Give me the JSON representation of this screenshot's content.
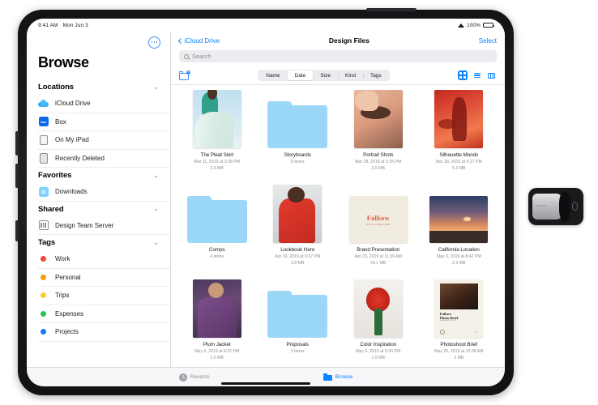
{
  "status_bar": {
    "time": "9:41 AM",
    "date": "Mon Jun 3",
    "wifi_icon": "wifi-icon",
    "battery_percent": "100%",
    "battery_icon": "battery-icon"
  },
  "sidebar": {
    "more_icon": "ellipsis-circle-icon",
    "title": "Browse",
    "sections": [
      {
        "header": "Locations",
        "chevron": "chevron-down-icon",
        "items": [
          {
            "label": "iCloud Drive",
            "icon": "icloud-drive-icon"
          },
          {
            "label": "Box",
            "icon": "box-app-icon",
            "icon_text": "box"
          },
          {
            "label": "On My iPad",
            "icon": "ipad-icon"
          },
          {
            "label": "Recently Deleted",
            "icon": "trash-ipad-icon"
          }
        ]
      },
      {
        "header": "Favorites",
        "chevron": "chevron-down-icon",
        "items": [
          {
            "label": "Downloads",
            "icon": "downloads-folder-icon"
          }
        ]
      },
      {
        "header": "Shared",
        "chevron": "chevron-down-icon",
        "items": [
          {
            "label": "Design Team Server",
            "icon": "server-icon"
          }
        ]
      },
      {
        "header": "Tags",
        "chevron": "chevron-down-icon",
        "items": [
          {
            "label": "Work",
            "icon": "tag-dot-icon",
            "color": "#f5463b"
          },
          {
            "label": "Personal",
            "icon": "tag-dot-icon",
            "color": "#f59f0b"
          },
          {
            "label": "Trips",
            "icon": "tag-dot-icon",
            "color": "#f7cf2e"
          },
          {
            "label": "Expenses",
            "icon": "tag-dot-icon",
            "color": "#2fc14f"
          },
          {
            "label": "Projects",
            "icon": "tag-dot-icon",
            "color": "#1a7bf0"
          }
        ]
      }
    ]
  },
  "detail": {
    "back_label": "iCloud Drive",
    "back_icon": "chevron-left-icon",
    "title": "Design Files",
    "select_label": "Select",
    "search": {
      "placeholder": "Search",
      "icon": "search-icon"
    },
    "new_folder_icon": "new-folder-icon",
    "sort_options": [
      "Name",
      "Date",
      "Size",
      "Kind",
      "Tags"
    ],
    "sort_selected": "Date",
    "view_modes": [
      {
        "name": "grid-view-icon",
        "active": true
      },
      {
        "name": "list-view-icon",
        "active": false
      },
      {
        "name": "column-view-icon",
        "active": false
      }
    ]
  },
  "files": [
    {
      "name": "The Pleat Skirt",
      "sub": "Mar 11, 2019 at 3:28 PM",
      "size": "2.6 MB",
      "type": "image",
      "art": "a-pleat",
      "shape": "tall"
    },
    {
      "name": "Storyboards",
      "sub": "8 items",
      "size": "",
      "type": "folder",
      "art": "",
      "shape": "folder"
    },
    {
      "name": "Portrait Shots",
      "sub": "Mar 28, 2019 at 5:25 PM",
      "size": "3.5 MB",
      "type": "image",
      "art": "a-portrait",
      "shape": "tall"
    },
    {
      "name": "Silhouette Moods",
      "sub": "Mar 28, 2019 at 6:17 PM",
      "size": "5.3 MB",
      "type": "image",
      "art": "a-silh",
      "shape": "tall"
    },
    {
      "name": "Comps",
      "sub": "4 items",
      "size": "",
      "type": "folder",
      "art": "",
      "shape": "folder"
    },
    {
      "name": "Lookbook Hero",
      "sub": "Apr 19, 2019 at 9:37 PM",
      "size": "3.8 MB",
      "type": "image",
      "art": "a-lookbook",
      "shape": "tall"
    },
    {
      "name": "Brand Presentation",
      "sub": "Apr 23, 2019 at 11:30 AM",
      "size": "54.1 MB",
      "type": "keynote",
      "art": "a-brand",
      "shape": "wide",
      "title_text": "Falkow",
      "subtitle_text": "Autumn / Winter 2019"
    },
    {
      "name": "California Location",
      "sub": "May 3, 2019 at 8:42 PM",
      "size": "2.3 MB",
      "type": "image",
      "art": "a-cali",
      "shape": "wide"
    },
    {
      "name": "Plum Jacket",
      "sub": "May 6, 2019 at 4:22 PM",
      "size": "1.6 MB",
      "type": "image",
      "art": "a-plum",
      "shape": "tall"
    },
    {
      "name": "Proposals",
      "sub": "3 items",
      "size": "",
      "type": "folder",
      "art": "",
      "shape": "folder"
    },
    {
      "name": "Color Inspiration",
      "sub": "May 6, 2019 at 5:34 PM",
      "size": "1.9 MB",
      "type": "image",
      "art": "a-color",
      "shape": "tall"
    },
    {
      "name": "Photoshoot Brief",
      "sub": "May 26, 2019 at 10:08 AM",
      "size": "2 MB",
      "type": "document",
      "art": "a-brief",
      "shape": "tall",
      "doc_title_1": "Falkow",
      "doc_title_2": "Photo Brief",
      "doc_sub": "LOOKBOOK F/W '19",
      "doc_page": "001"
    }
  ],
  "tab_bar": {
    "tabs": [
      {
        "label": "Recents",
        "icon": "clock-icon",
        "active": false
      },
      {
        "label": "Browse",
        "icon": "folder-icon",
        "active": true
      }
    ]
  },
  "accessory": {
    "name": "usb-flash-drive",
    "brand": "SanDisk"
  }
}
